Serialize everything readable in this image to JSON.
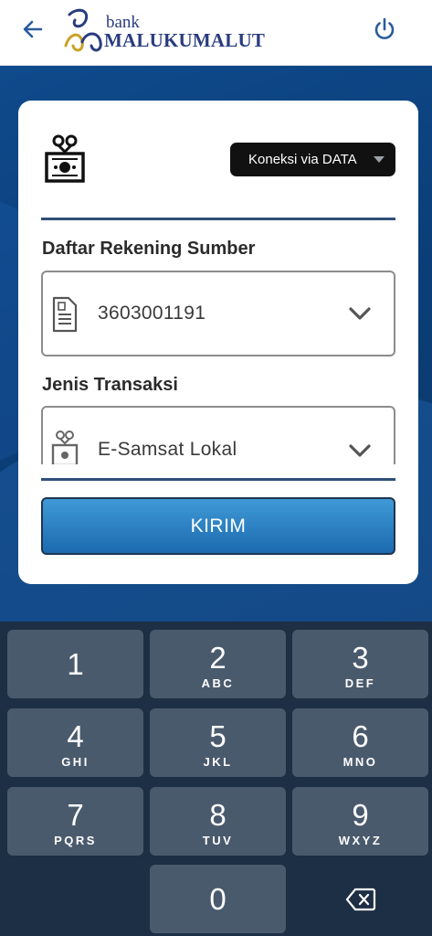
{
  "header": {
    "logo_small": "bank",
    "logo_big": "MALUKUMALUT",
    "back_icon": "arrow-left-icon",
    "power_icon": "power-icon",
    "accent_color": "#2a3c7f"
  },
  "card": {
    "connection_button": "Koneksi via DATA",
    "source_account": {
      "label": "Daftar Rekening Sumber",
      "value": "3603001191"
    },
    "transaction_type": {
      "label": "Jenis Transaksi",
      "value": "E-Samsat Lokal"
    },
    "submit_label": "KIRIM"
  },
  "keypad": {
    "keys": [
      {
        "num": "1",
        "letters": ""
      },
      {
        "num": "2",
        "letters": "ABC"
      },
      {
        "num": "3",
        "letters": "DEF"
      },
      {
        "num": "4",
        "letters": "GHI"
      },
      {
        "num": "5",
        "letters": "JKL"
      },
      {
        "num": "6",
        "letters": "MNO"
      },
      {
        "num": "7",
        "letters": "PQRS"
      },
      {
        "num": "8",
        "letters": "TUV"
      },
      {
        "num": "9",
        "letters": "WXYZ"
      },
      {
        "num": "0",
        "letters": ""
      }
    ],
    "backspace_icon": "backspace-icon"
  }
}
